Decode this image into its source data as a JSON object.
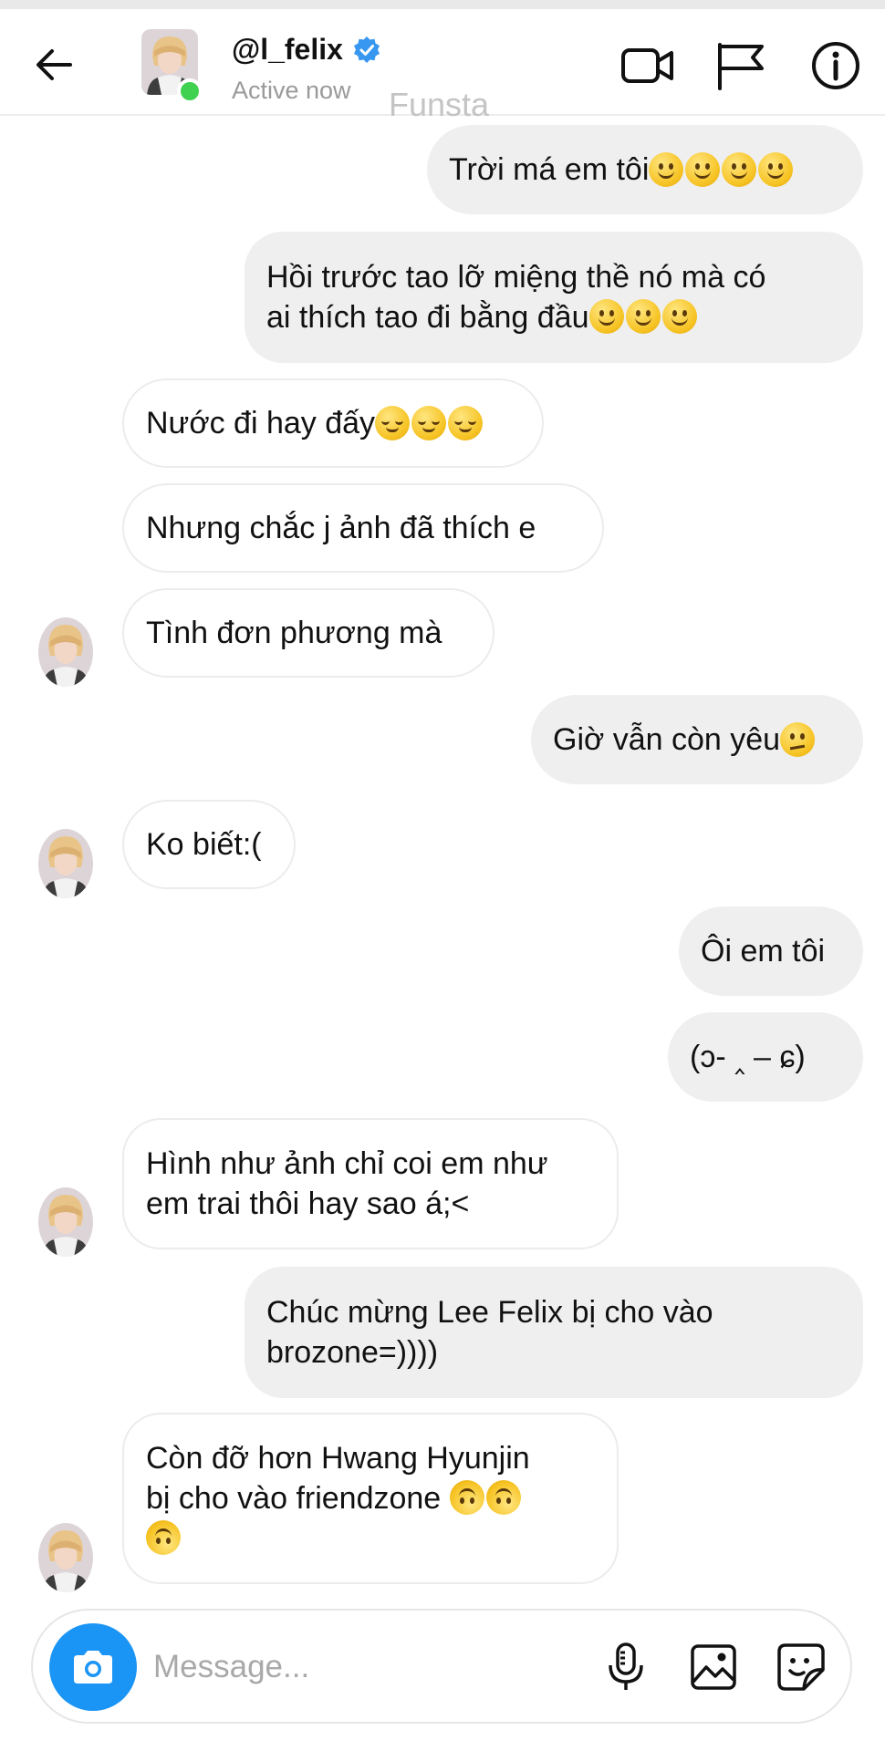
{
  "header": {
    "username": "@l_felix",
    "status": "Active now",
    "watermark": "Funsta"
  },
  "icons": {
    "back": "arrow-left-icon",
    "verified": "verified-badge-icon",
    "video": "video-camera-icon",
    "flag": "flag-icon",
    "info": "info-icon",
    "camera": "camera-icon",
    "mic": "microphone-icon",
    "gallery": "image-icon",
    "sticker": "sticker-icon"
  },
  "colors": {
    "accent": "#1b95f5",
    "online": "#3fd14f",
    "outgoing_bubble": "#efefef",
    "incoming_border": "#ececec"
  },
  "messages": [
    {
      "dir": "out",
      "text": "Trời má em tôi"
    },
    {
      "dir": "out",
      "line1": "Hồi trước tao lỡ miệng thề nó mà có",
      "line2": "ai thích tao đi bằng đầu"
    },
    {
      "dir": "in",
      "text": "Nước đi hay đấy"
    },
    {
      "dir": "in",
      "text": "Nhưng chắc j ảnh đã thích e"
    },
    {
      "dir": "in",
      "text": "Tình đơn phương mà"
    },
    {
      "dir": "out",
      "text": "Giờ vẫn còn yêu"
    },
    {
      "dir": "in",
      "text": "Ko biết:("
    },
    {
      "dir": "out",
      "text": "Ôi em tôi"
    },
    {
      "dir": "out",
      "text": "(ↄ- ‸ – ɕ)"
    },
    {
      "dir": "in",
      "line1": "Hình như ảnh chỉ coi em như",
      "line2": "em trai thôi hay sao á;<"
    },
    {
      "dir": "out",
      "line1": "Chúc mừng Lee Felix bị cho vào",
      "line2": "brozone=))))"
    },
    {
      "dir": "in",
      "line1": "Còn đỡ hơn Hwang Hyunjin",
      "line2": "bị cho vào friendzone "
    }
  ],
  "composer": {
    "placeholder": "Message..."
  }
}
